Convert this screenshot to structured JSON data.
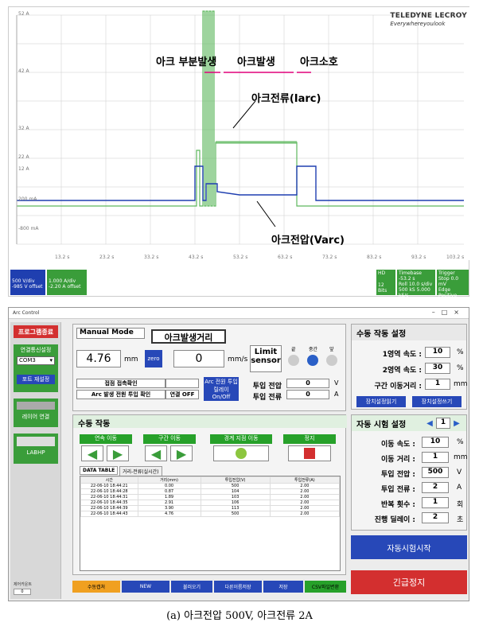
{
  "scope": {
    "brand": "TELEDYNE LECROY",
    "brand_tagline": "Everywhereyoulook",
    "y_ticks": [
      "52 A",
      "42 A",
      "32 A",
      "22 A",
      "12 A",
      "200 mA",
      "-800 mA"
    ],
    "x_ticks": [
      "13.2 s",
      "23.2 s",
      "33.2 s",
      "43.2 s",
      "53.2 s",
      "63.2 s",
      "73.2 s",
      "83.2 s",
      "93.2 s",
      "103.2 s"
    ],
    "annotations": {
      "arc_partial": "아크 부분발생",
      "arc_on": "아크발생",
      "arc_off": "아크소호",
      "arc_current": "아크전류(Iarc)",
      "arc_voltage": "아크전압(Varc)"
    },
    "c1_box": {
      "line1": "500 V/div",
      "line2": "-985 V offset"
    },
    "c4_box": {
      "line1": "1.000 A/div",
      "line2": "-2.20 A offset"
    },
    "hd_box": {
      "label": "HD",
      "bits": "12 Bits"
    },
    "timebase": {
      "label": "Timebase",
      "value": "-53.2 s",
      "roll": "Roll",
      "div": "10.0 s/div",
      "samples": "500 kS",
      "rate": "5.000 kS/s"
    },
    "trigger": {
      "label": "Trigger",
      "mode": "Stop",
      "level": "0.0 mV",
      "type": "Edge",
      "slope": "Positive"
    }
  },
  "app": {
    "title": "Arc Control",
    "exit_button": "프로그램종료",
    "comm_label": "연결통신설정",
    "com_port": "COM3",
    "port_reset": "포트 재설정",
    "relay_connect": "레이어 연결",
    "labhp": "LABHP",
    "tiny_label": "제어카운트",
    "tiny_value": "0",
    "manual_mode": "Manual Mode",
    "arc_distance_callout": "아크발생거리",
    "pos_value": "4.76",
    "pos_unit": "mm",
    "zero_button": "zero",
    "speed_value": "0",
    "speed_unit": "mm/s",
    "limit_label": "Limit sensor",
    "limit_leds": [
      "끝",
      "중간",
      "앞"
    ],
    "contact_check": "접점 접촉확인",
    "arc_power_check": "Arc 발생 전원 투입 확인",
    "connect_off": "연결 OFF",
    "arc_relay": "Arc 전원 투입 릴레이 On/Off",
    "input_voltage_label": "투입 전압",
    "input_voltage_value": "0",
    "input_voltage_unit": "V",
    "input_current_label": "투입 전류",
    "input_current_value": "0",
    "input_current_unit": "A",
    "manual_title": "수동 작동",
    "continuous_move": "연속 이동",
    "section_move": "구간 이동",
    "boundary_move": "경계 지점 이동",
    "stop": "정지",
    "tab_data": "DATA TABLE",
    "tab_distance": "거리-전류(실시간)",
    "table_headers": [
      "시간",
      "거리(mm)",
      "투입전압(V)",
      "투입전류(A)"
    ],
    "table_rows": [
      [
        "22-06-10 18:44:21",
        "0.00",
        "500",
        "2.00"
      ],
      [
        "22-06-10 18:44:28",
        "0.87",
        "104",
        "2.00"
      ],
      [
        "22-06-10 18:44:31",
        "1.89",
        "103",
        "2.00"
      ],
      [
        "22-06-10 18:44:35",
        "2.91",
        "106",
        "2.00"
      ],
      [
        "22-06-10 18:44:39",
        "3.90",
        "113",
        "2.00"
      ],
      [
        "22-06-10 18:44:43",
        "4.76",
        "500",
        "2.00"
      ]
    ],
    "bottom_buttons": [
      "수동캡쳐",
      "NEW",
      "불러오기",
      "다른이름저장",
      "저장",
      "CSV파일변환"
    ],
    "manual_settings_title": "수동 작동 설정",
    "zone1_speed_label": "1영역 속도 :",
    "zone1_speed_value": "10",
    "zone2_speed_label": "2영역 속도 :",
    "zone2_speed_value": "30",
    "percent": "%",
    "section_distance_label": "구간 이동거리 :",
    "section_distance_value": "1",
    "mm": "mm",
    "read_settings": "장치설정읽기",
    "write_settings": "장치설정쓰기",
    "auto_title": "자동 시험 설정",
    "auto_index": "1",
    "move_speed_label": "이동 속도 :",
    "move_speed_value": "10",
    "move_distance_label": "이동 거리 :",
    "move_distance_value": "1",
    "applied_voltage_label": "투입 전압 :",
    "applied_voltage_value": "500",
    "v": "V",
    "applied_current_label": "투입 전류 :",
    "applied_current_value": "2",
    "a": "A",
    "repeat_label": "반복 횟수 :",
    "repeat_value": "1",
    "repeat_unit": "회",
    "delay_label": "진행 딜레이 :",
    "delay_value": "2",
    "delay_unit": "초",
    "auto_start": "자동시험시작",
    "emergency_stop": "긴급정지"
  },
  "caption": "(a) 아크전압 500V, 아크전류 2A"
}
